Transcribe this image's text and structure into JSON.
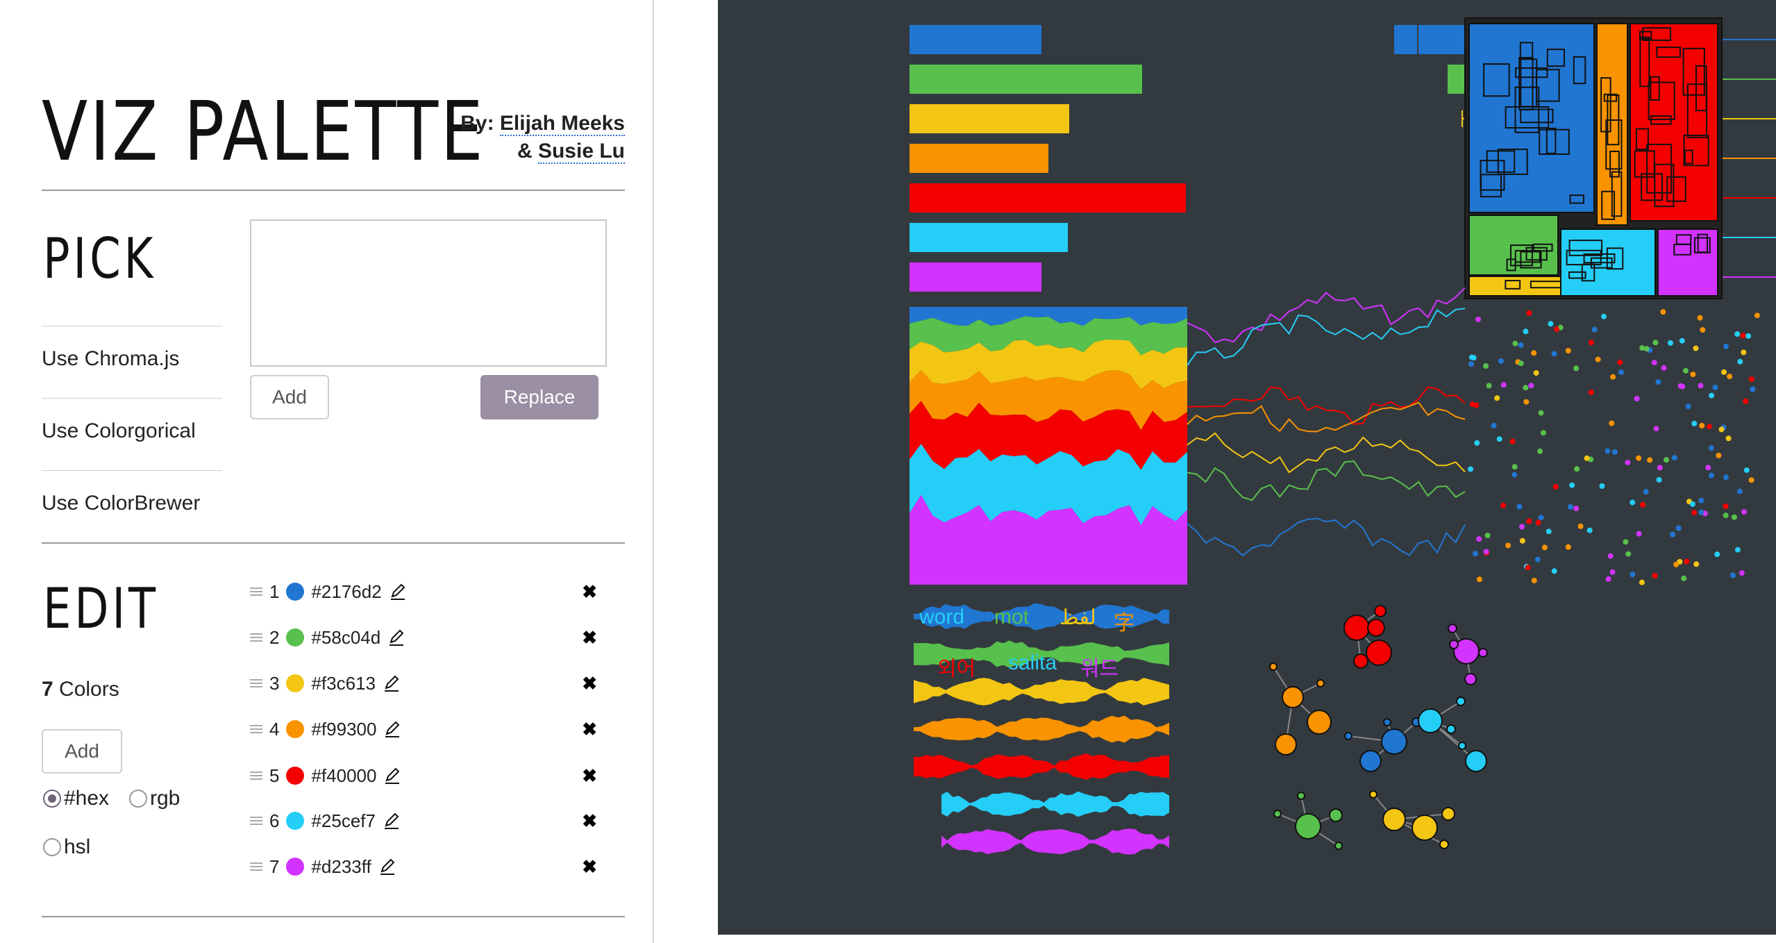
{
  "header": {
    "title": "VIZ PALETTE",
    "by_prefix": "By:",
    "author1": "Elijah Meeks",
    "author2_prefix": "&",
    "author2": "Susie Lu"
  },
  "pick": {
    "title": "PICK",
    "links": [
      "Use Chroma.js",
      "Use Colorgorical",
      "Use ColorBrewer"
    ],
    "textarea_value": "",
    "add_label": "Add",
    "replace_label": "Replace"
  },
  "edit": {
    "title": "EDIT",
    "count": "7",
    "count_suffix": " Colors",
    "add_label": "Add",
    "formats": [
      {
        "label": "#hex",
        "selected": true
      },
      {
        "label": "rgb",
        "selected": false
      },
      {
        "label": "hsl",
        "selected": false
      }
    ],
    "colors": [
      {
        "index": "1",
        "hex": "#2176d2"
      },
      {
        "index": "2",
        "hex": "#58c04d"
      },
      {
        "index": "3",
        "hex": "#f3c613"
      },
      {
        "index": "4",
        "hex": "#f99300"
      },
      {
        "index": "5",
        "hex": "#f40000"
      },
      {
        "index": "6",
        "hex": "#25cef7"
      },
      {
        "index": "7",
        "hex": "#d233ff"
      }
    ]
  },
  "preview": {
    "background": "#333a3f",
    "words": [
      "word",
      "mot",
      "لفظ",
      "字",
      "외어",
      "salita",
      "워드"
    ]
  },
  "icons": [
    "drag-handle-icon",
    "pencil-icon",
    "close-icon",
    "resize-icon"
  ]
}
